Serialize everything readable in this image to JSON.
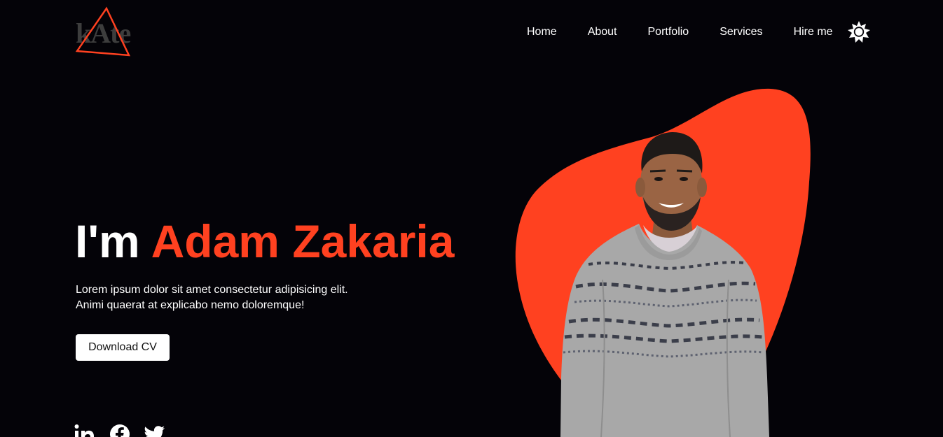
{
  "header": {
    "logo_text": "kAte",
    "nav": [
      {
        "label": "Home"
      },
      {
        "label": "About"
      },
      {
        "label": "Portfolio"
      },
      {
        "label": "Services"
      },
      {
        "label": "Hire me"
      }
    ],
    "theme_icon": "sun-icon"
  },
  "hero": {
    "greeting": "I'm",
    "name": "Adam Zakaria",
    "description": [
      "Lorem ipsum dolor sit amet consectetur adipisicing elit.",
      "Animi quaerat at explicabo nemo doloremque!"
    ],
    "button_label": "Download CV"
  },
  "social": [
    {
      "icon": "linkedin-icon"
    },
    {
      "icon": "facebook-icon"
    },
    {
      "icon": "twitter-icon"
    }
  ],
  "colors": {
    "background": "#040308",
    "accent": "#ff4120",
    "text": "#ffffff"
  }
}
